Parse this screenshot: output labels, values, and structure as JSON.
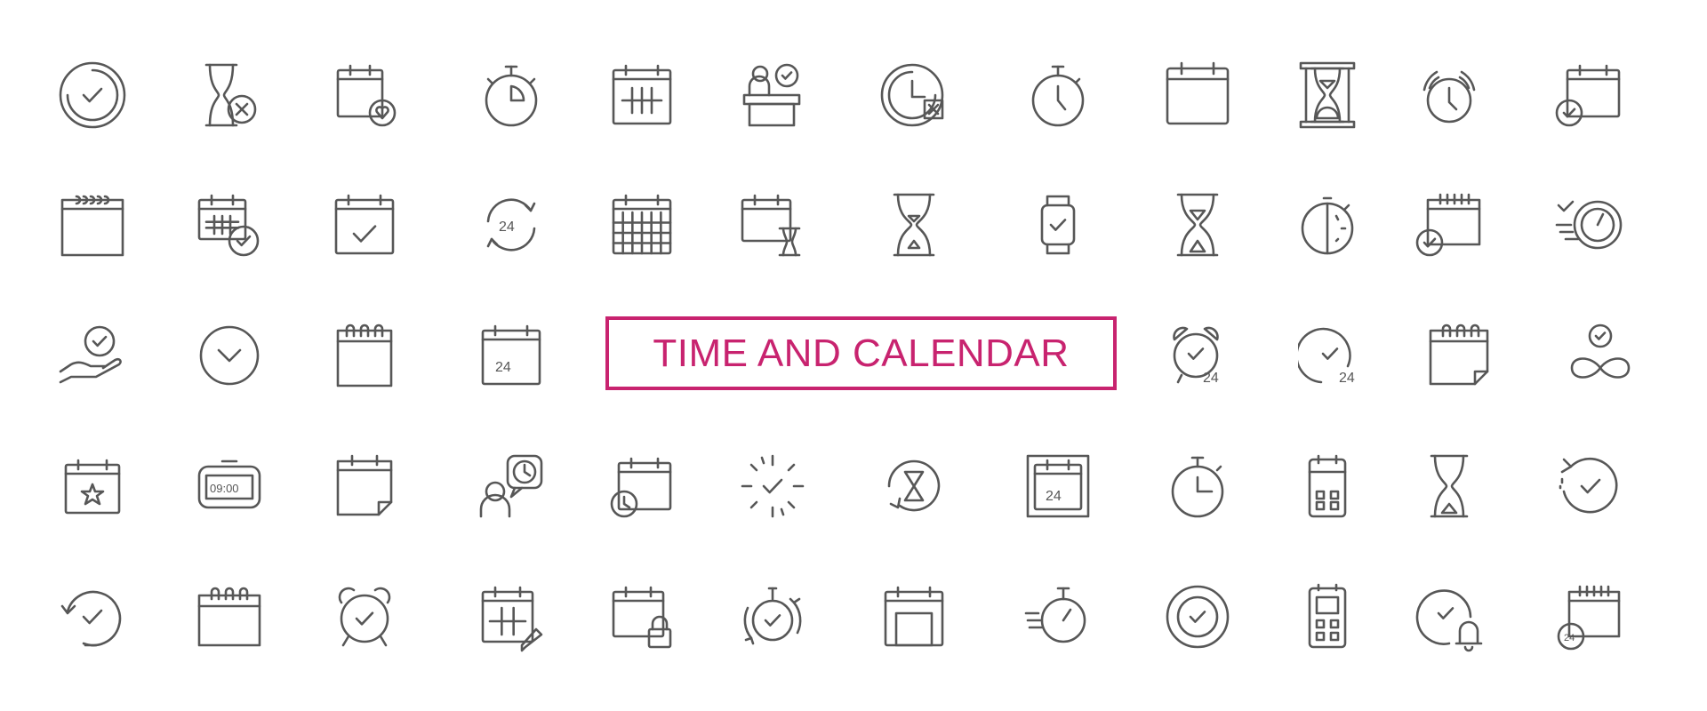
{
  "title": "TIME AND CALENDAR",
  "colors": {
    "accent": "#c8236f",
    "icon_stroke": "#575757",
    "background": "#ffffff"
  },
  "icons": [
    [
      "clock-check",
      "hourglass-cancel",
      "calendar-heart",
      "stopwatch",
      "calendar-grid",
      "reception-desk-check",
      "clock-cancel",
      "stopwatch-time",
      "blank-calendar",
      "hourglass-frame",
      "alarm-ringing",
      "calendar-check"
    ],
    [
      "spiral-calendar",
      "calendar-dates-check",
      "calendar-checkmark",
      "24-hours-cycle",
      "calendar-full-grid",
      "calendar-hourglass",
      "hourglass",
      "smartwatch-check",
      "hourglass-sand",
      "timer-half",
      "calendar-check-badge",
      "fast-speed-check"
    ],
    [
      "hand-check",
      "circle-chevron-down",
      "spiral-notepad",
      "calendar-24",
      "TITLE",
      "alarm-24",
      "clock-check-24",
      "spiral-calendar-page",
      "infinity-check"
    ],
    [
      "calendar-star",
      "digital-clock",
      "calendar-page-curl",
      "person-chat-clock",
      "calendar-clock",
      "check-burst",
      "hourglass-refresh",
      "calendar-24-framed",
      "timer-quarter",
      "mobile-calendar",
      "hourglass-simple",
      "rewind-check"
    ],
    [
      "history-check",
      "ring-calendar",
      "alarm-clock-check",
      "calendar-edit",
      "calendar-lock",
      "stopwatch-refresh-check",
      "calendar-window",
      "fast-stopwatch",
      "target-check",
      "mobile-device",
      "clock-bell",
      "calendar-24-clock"
    ]
  ],
  "labels": {
    "24": "24",
    "digital": "09:00"
  }
}
